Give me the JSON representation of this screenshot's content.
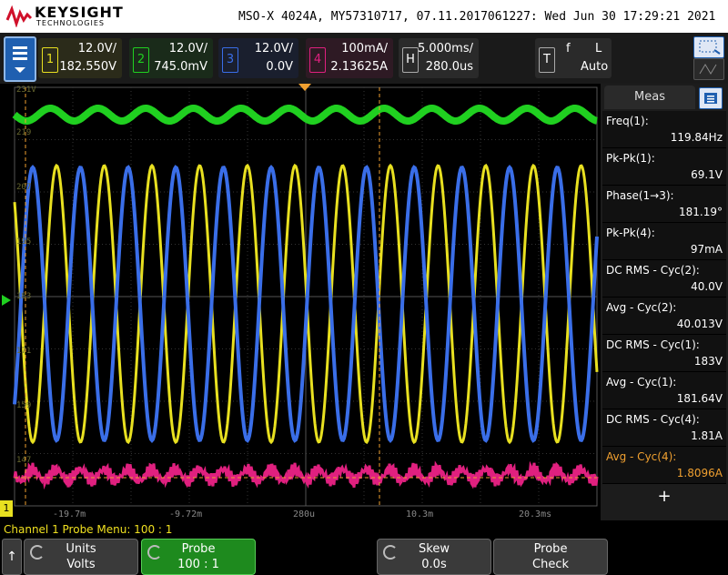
{
  "header": {
    "brand": "KEYSIGHT",
    "brand_sub": "TECHNOLOGIES",
    "title": "MSO-X 4024A, MY57310717, 07.11.2017061227: Wed Jun 30 17:29:21 2021"
  },
  "channels": [
    {
      "num": "1",
      "scale": "12.0V/",
      "offset": "182.550V",
      "color": "#e8e020"
    },
    {
      "num": "2",
      "scale": "12.0V/",
      "offset": "745.0mV",
      "color": "#20d020"
    },
    {
      "num": "3",
      "scale": "12.0V/",
      "offset": "0.0V",
      "color": "#3a6ee8"
    },
    {
      "num": "4",
      "scale": "100mA/",
      "offset": "2.13625A",
      "color": "#e0207f"
    }
  ],
  "horizontal": {
    "key": "H",
    "scale": "5.000ms/",
    "delay": "280.0us"
  },
  "trigger": {
    "key": "T",
    "slope": "f",
    "source": "L",
    "mode": "Auto"
  },
  "plot": {
    "left_labels": [
      "231V",
      "219",
      "207",
      "195",
      "183",
      "171",
      "159",
      "147"
    ],
    "time_labels": [
      "-19.7m",
      "-9.72m",
      "280u",
      "10.3m",
      "20.3ms"
    ],
    "ch1_marker": "1"
  },
  "meas": {
    "tab": "Meas",
    "items": [
      {
        "label": "Freq(1):",
        "value": "119.84Hz"
      },
      {
        "label": "Pk-Pk(1):",
        "value": "69.1V"
      },
      {
        "label": "Phase(1→3):",
        "value": "181.19°"
      },
      {
        "label": "Pk-Pk(4):",
        "value": "97mA"
      },
      {
        "label": "DC RMS - Cyc(2):",
        "value": "40.0V"
      },
      {
        "label": "Avg - Cyc(2):",
        "value": "40.013V"
      },
      {
        "label": "DC RMS - Cyc(1):",
        "value": "183V"
      },
      {
        "label": "Avg - Cyc(1):",
        "value": "181.64V"
      },
      {
        "label": "DC RMS - Cyc(4):",
        "value": "1.81A"
      },
      {
        "label": "Avg - Cyc(4):",
        "value": "1.8096A"
      }
    ],
    "add": "+"
  },
  "status": "Channel 1 Probe Menu: 100 : 1",
  "softkeys": [
    {
      "l1": "Units",
      "l2": "Volts"
    },
    {
      "l1": "Probe",
      "l2": "100 : 1"
    },
    {
      "l1": "Skew",
      "l2": "0.0s"
    },
    {
      "l1": "Probe",
      "l2": "Check"
    }
  ],
  "back_arrow": "↑"
}
